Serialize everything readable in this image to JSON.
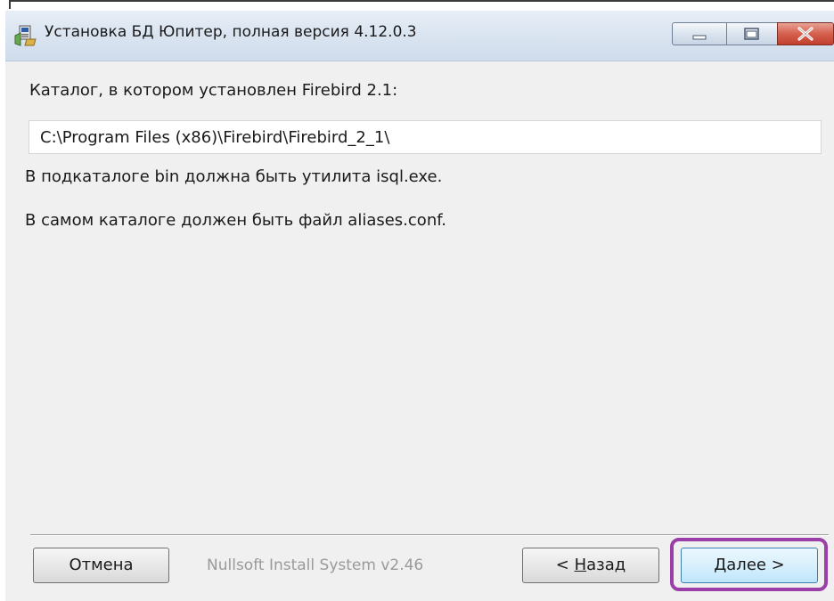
{
  "window": {
    "title": "Установка БД Юпитер, полная версия 4.12.0.3"
  },
  "titlebar_buttons": {
    "minimize": "minimize-icon",
    "maximize": "maximize-icon",
    "close": "close-icon"
  },
  "content": {
    "prompt": "Каталог, в котором установлен Firebird 2.1:",
    "path_value": "C:\\Program Files (x86)\\Firebird\\Firebird_2_1\\",
    "hint_bin": "В подкаталоге bin должна быть утилита isql.exe.",
    "hint_aliases": "В самом каталоге должен быть файл aliases.conf."
  },
  "footer": {
    "cancel_label": "Отмена",
    "branding": "Nullsoft Install System v2.46",
    "back_label": "< Назад",
    "next_label": "Далее >"
  },
  "colors": {
    "highlight": "#9b3fa8",
    "window_bg": "#f0f0f0",
    "close_button": "#c23f2d"
  }
}
